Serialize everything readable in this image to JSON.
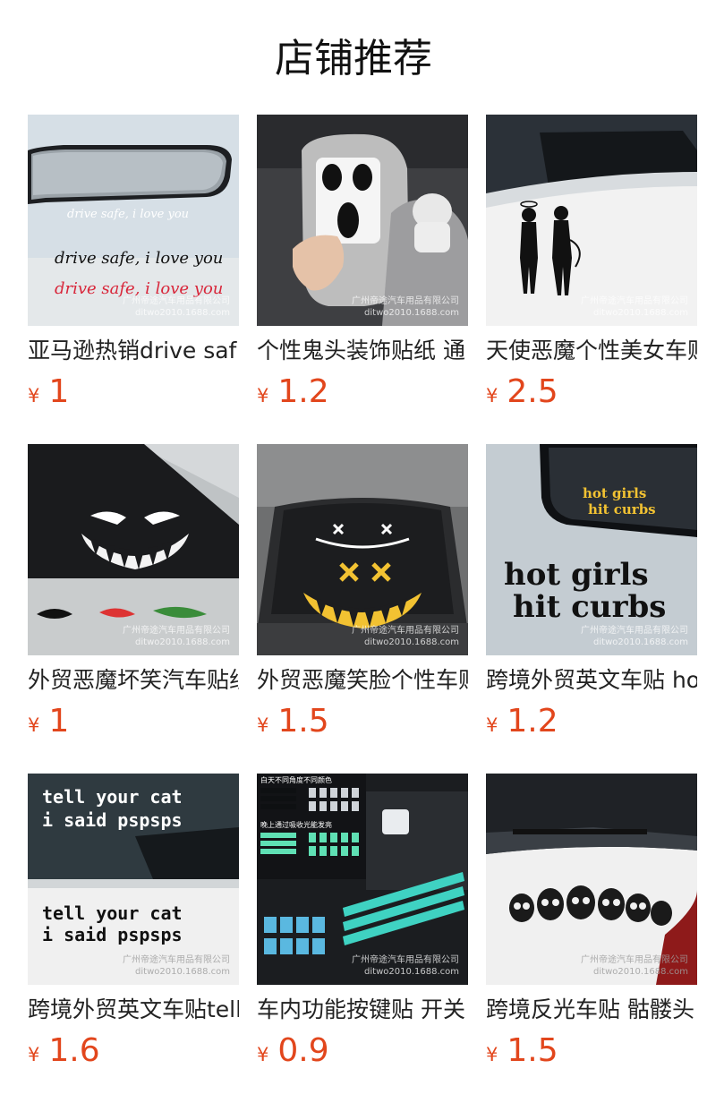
{
  "page": {
    "title": "店铺推荐"
  },
  "watermark": {
    "line1": "广州帝途汽车用品有限公司",
    "line2": "ditwo2010.1688.com"
  },
  "currency_symbol": "¥",
  "products": [
    {
      "name": "亚马逊热销drive saf",
      "price": "1",
      "image_text_1": "drive safe, i love you",
      "image_text_2": "drive safe, i love you",
      "image_text_3": "drive safe, i love you"
    },
    {
      "name": "个性鬼头装饰贴纸 通",
      "price": "1.2"
    },
    {
      "name": "天使恶魔个性美女车贴",
      "price": "2.5"
    },
    {
      "name": "外贸恶魔坏笑汽车贴纸",
      "price": "1"
    },
    {
      "name": "外贸恶魔笑脸个性车贴",
      "price": "1.5"
    },
    {
      "name": "跨境外贸英文车贴 hot",
      "price": "1.2",
      "image_text_1": "hot girls",
      "image_text_2": "hit curbs"
    },
    {
      "name": "跨境外贸英文车贴tell",
      "price": "1.6",
      "image_text_1": "tell your cat",
      "image_text_2": "i said pspsps"
    },
    {
      "name": "车内功能按键贴 开关",
      "price": "0.9",
      "image_text_1": "白天不同角度不同颜色",
      "image_text_2": "晚上通过吸收光能发亮"
    },
    {
      "name": "跨境反光车贴 骷髅头",
      "price": "1.5"
    }
  ]
}
